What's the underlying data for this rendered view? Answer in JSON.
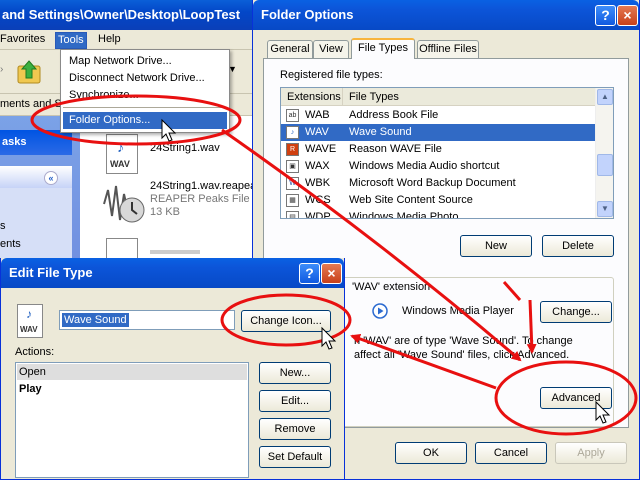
{
  "explorer": {
    "title": "and Settings\\Owner\\Desktop\\LoopTest",
    "menu": {
      "favorites": "Favorites",
      "tools": "Tools",
      "help": "Help"
    },
    "address_fragment": "ments and S",
    "left_panel": {
      "tasks_header": "asks",
      "item1": "s",
      "item2": "ents"
    },
    "files": [
      {
        "name": "24String1.wav",
        "icon_label": "WAV"
      },
      {
        "name": "24String1.wav.reapeaks",
        "type": "REAPER Peaks File",
        "size": "13 KB"
      }
    ]
  },
  "tools_menu": {
    "items": [
      "Map Network Drive...",
      "Disconnect Network Drive...",
      "Synchronize...",
      "Folder Options..."
    ],
    "highlighted": "Folder Options..."
  },
  "folder_options": {
    "title": "Folder Options",
    "help_btn": "?",
    "close_btn": "×",
    "tabs": [
      "General",
      "View",
      "File Types",
      "Offline Files"
    ],
    "active_tab": "File Types",
    "registered_label": "Registered file types:",
    "columns": [
      "Extensions",
      "File Types"
    ],
    "rows": [
      {
        "ext": "WAB",
        "type": "Address Book File",
        "icon": "ab"
      },
      {
        "ext": "WAV",
        "type": "Wave Sound",
        "icon": "♪",
        "selected": true
      },
      {
        "ext": "WAVE",
        "type": "Reason WAVE File",
        "icon": "R"
      },
      {
        "ext": "WAX",
        "type": "Windows Media Audio shortcut",
        "icon": "▣"
      },
      {
        "ext": "WBK",
        "type": "Microsoft Word Backup Document",
        "icon": "W"
      },
      {
        "ext": "WCS",
        "type": "Web Site Content Source",
        "icon": "▦"
      },
      {
        "ext": "WDP",
        "type": "Windows Media Photo",
        "icon": "▤"
      }
    ],
    "new_btn": "New",
    "delete_btn": "Delete",
    "details_heading": "'WAV' extension",
    "opens_with": "Windows Media Player",
    "change_btn": "Change...",
    "desc_line1": "n 'WAV' are of type 'Wave Sound'.  To change",
    "desc_line2": "affect all 'Wave Sound' files, click Advanced.",
    "advanced_btn": "Advanced",
    "ok_btn": "OK",
    "cancel_btn": "Cancel",
    "apply_btn": "Apply"
  },
  "edit_file_type": {
    "title": "Edit File Type",
    "help_btn": "?",
    "close_btn": "×",
    "name_value": "Wave Sound",
    "change_icon_btn": "Change Icon...",
    "actions_label": "Actions:",
    "actions": [
      "Open",
      "Play"
    ],
    "new_btn": "New...",
    "edit_btn": "Edit...",
    "remove_btn": "Remove",
    "set_default_btn": "Set Default",
    "icon_label": "WAV"
  },
  "colors": {
    "xp_blue": "#0a5fd8",
    "selection": "#316ac5",
    "annotation_red": "#e81010",
    "dialog_bg": "#ece9d8"
  }
}
